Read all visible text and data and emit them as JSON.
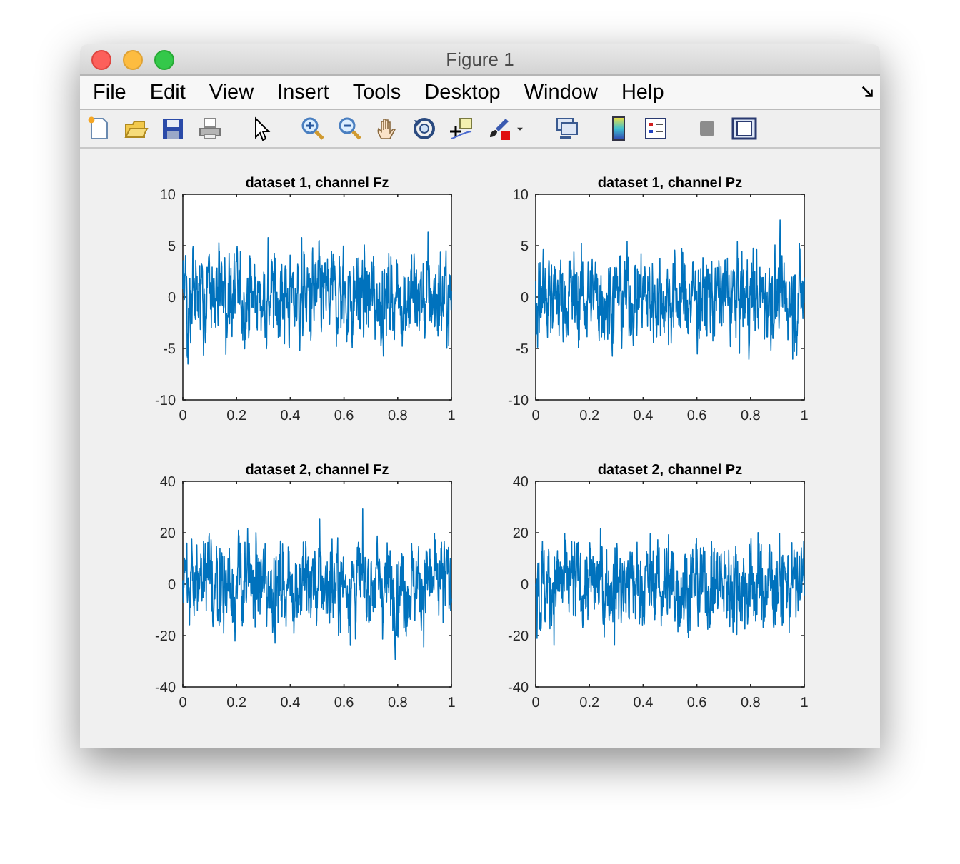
{
  "window": {
    "title": "Figure 1"
  },
  "menu": [
    "File",
    "Edit",
    "View",
    "Insert",
    "Tools",
    "Desktop",
    "Window",
    "Help"
  ],
  "plots": [
    {
      "title": "dataset 1, channel Fz",
      "xticks": [
        "0",
        "0.2",
        "0.4",
        "0.6",
        "0.8",
        "1"
      ],
      "yticks": [
        "10",
        "5",
        "0",
        "-5",
        "-10"
      ]
    },
    {
      "title": "dataset 1, channel Pz",
      "xticks": [
        "0",
        "0.2",
        "0.4",
        "0.6",
        "0.8",
        "1"
      ],
      "yticks": [
        "10",
        "5",
        "0",
        "-5",
        "-10"
      ]
    },
    {
      "title": "dataset 2, channel Fz",
      "xticks": [
        "0",
        "0.2",
        "0.4",
        "0.6",
        "0.8",
        "1"
      ],
      "yticks": [
        "40",
        "20",
        "0",
        "-20",
        "-40"
      ]
    },
    {
      "title": "dataset 2, channel Pz",
      "xticks": [
        "0",
        "0.2",
        "0.4",
        "0.6",
        "0.8",
        "1"
      ],
      "yticks": [
        "40",
        "20",
        "0",
        "-20",
        "-40"
      ]
    }
  ]
}
